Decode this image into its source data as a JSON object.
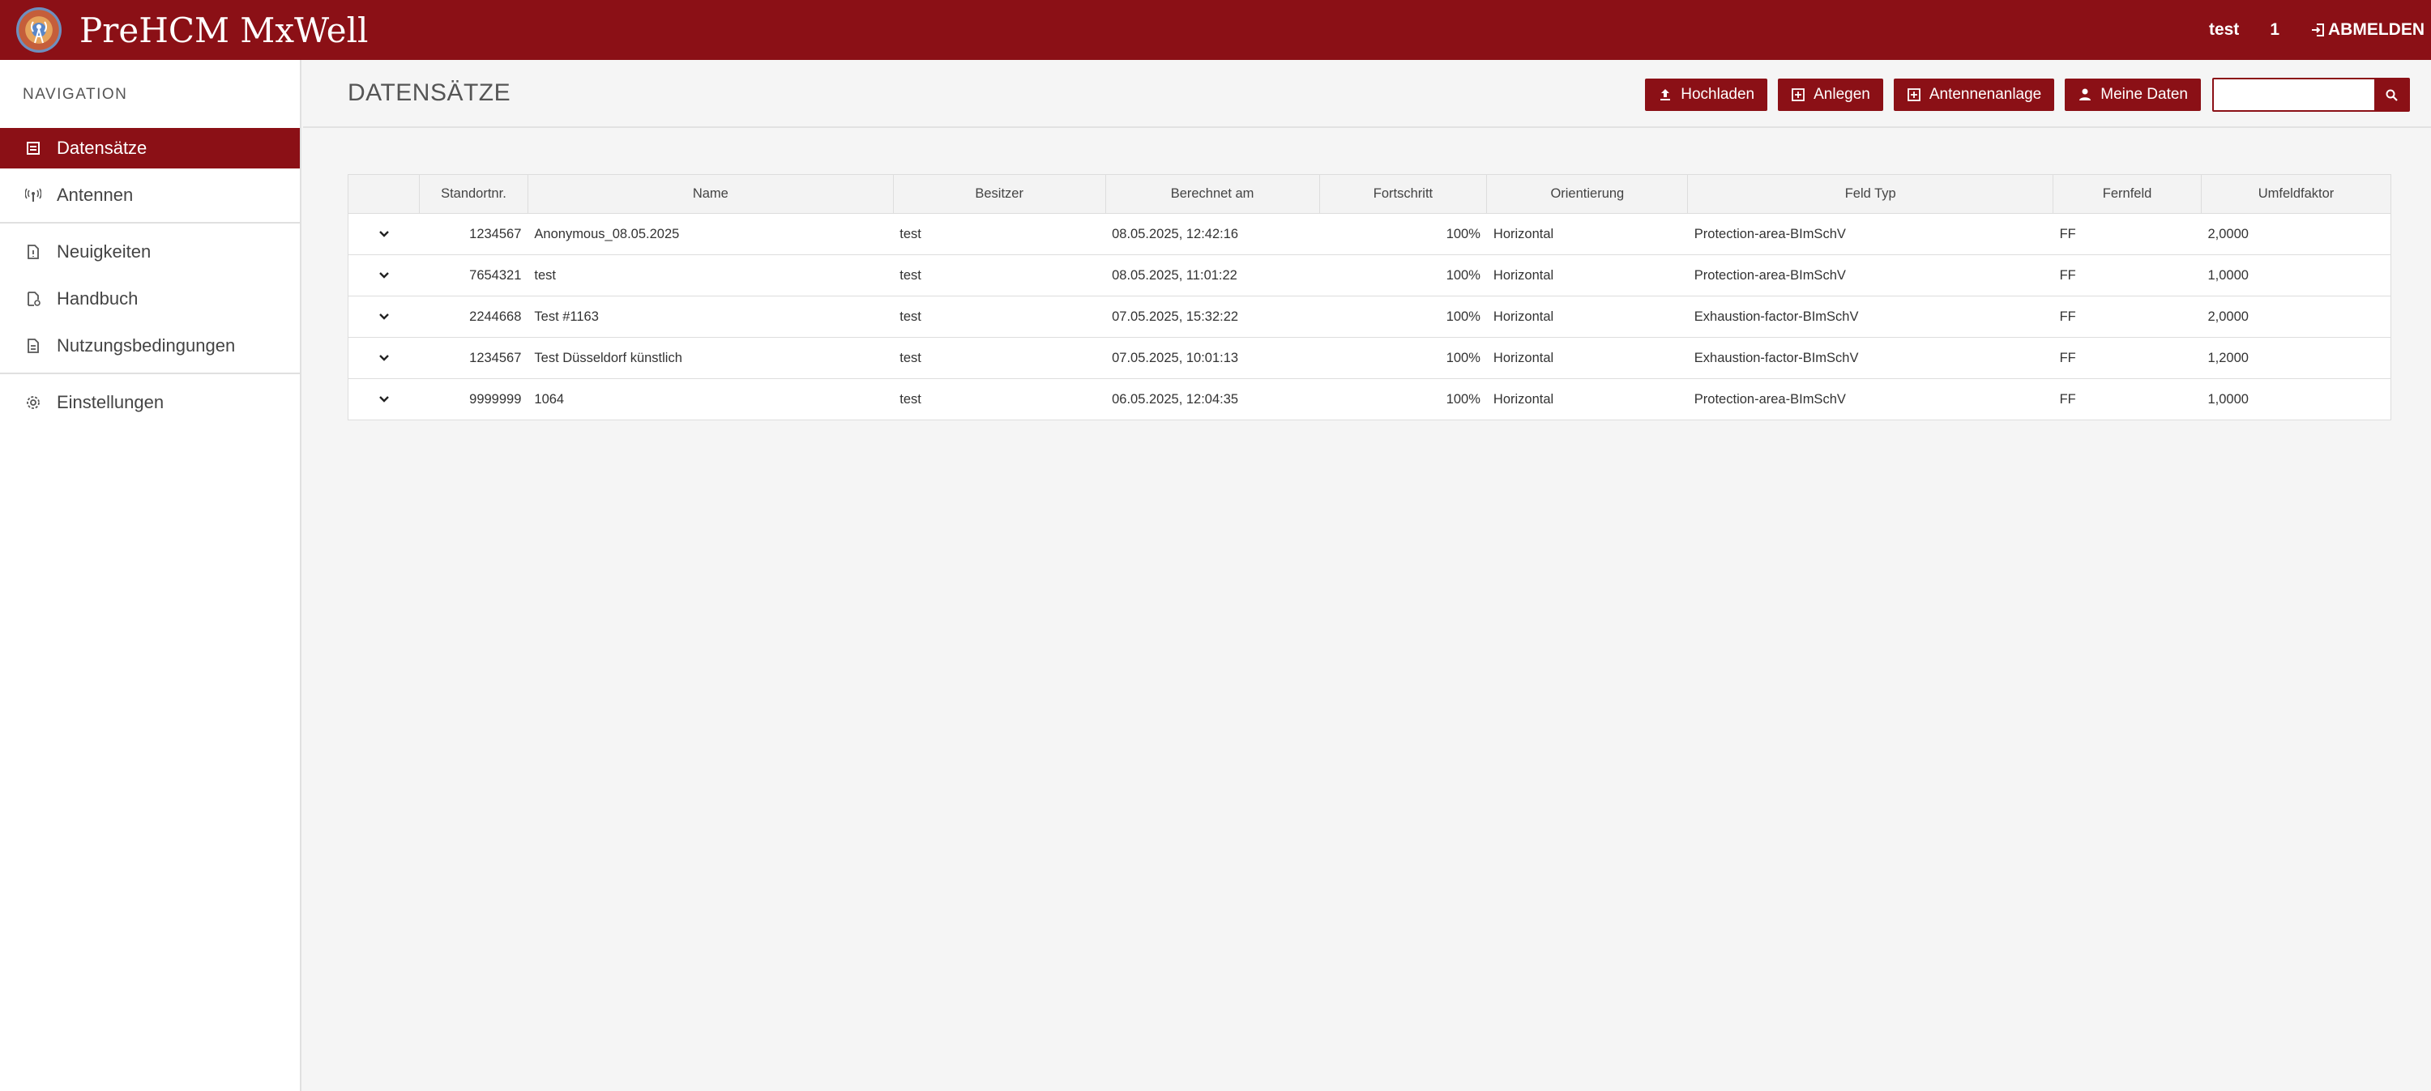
{
  "app": {
    "title": "PreHCM MxWell"
  },
  "topbar": {
    "user": "test",
    "count": "1",
    "logout_label": "ABMELDEN"
  },
  "sidebar": {
    "heading": "NAVIGATION",
    "items": [
      {
        "label": "Datensätze",
        "icon": "list-icon",
        "active": true
      },
      {
        "label": "Antennen",
        "icon": "antenna-icon"
      },
      {
        "label": "Neuigkeiten",
        "icon": "news-icon"
      },
      {
        "label": "Handbuch",
        "icon": "manual-icon"
      },
      {
        "label": "Nutzungsbedingungen",
        "icon": "terms-icon"
      },
      {
        "label": "Einstellungen",
        "icon": "gear-icon"
      }
    ]
  },
  "main": {
    "title": "DATENSÄTZE",
    "toolbar": {
      "upload_label": "Hochladen",
      "create_label": "Anlegen",
      "antenna_system_label": "Antennenanlage",
      "my_data_label": "Meine Daten",
      "search_placeholder": ""
    }
  },
  "table": {
    "columns": [
      "",
      "Standortnr.",
      "Name",
      "Besitzer",
      "Berechnet am",
      "Fortschritt",
      "Orientierung",
      "Feld Typ",
      "Fernfeld",
      "Umfeldfaktor"
    ],
    "rows": [
      {
        "standort": "1234567",
        "name": "Anonymous_08.05.2025",
        "besitzer": "test",
        "berechnet": "08.05.2025, 12:42:16",
        "fortschritt": "100%",
        "orientierung": "Horizontal",
        "feldtyp": "Protection-area-BImSchV",
        "fernfeld": "FF",
        "umfeld": "2,0000"
      },
      {
        "standort": "7654321",
        "name": "test",
        "besitzer": "test",
        "berechnet": "08.05.2025, 11:01:22",
        "fortschritt": "100%",
        "orientierung": "Horizontal",
        "feldtyp": "Protection-area-BImSchV",
        "fernfeld": "FF",
        "umfeld": "1,0000"
      },
      {
        "standort": "2244668",
        "name": "Test #1163",
        "besitzer": "test",
        "berechnet": "07.05.2025, 15:32:22",
        "fortschritt": "100%",
        "orientierung": "Horizontal",
        "feldtyp": "Exhaustion-factor-BImSchV",
        "fernfeld": "FF",
        "umfeld": "2,0000"
      },
      {
        "standort": "1234567",
        "name": "Test Düsseldorf künstlich",
        "besitzer": "test",
        "berechnet": "07.05.2025, 10:01:13",
        "fortschritt": "100%",
        "orientierung": "Horizontal",
        "feldtyp": "Exhaustion-factor-BImSchV",
        "fernfeld": "FF",
        "umfeld": "1,2000"
      },
      {
        "standort": "9999999",
        "name": "1064",
        "besitzer": "test",
        "berechnet": "06.05.2025, 12:04:35",
        "fortschritt": "100%",
        "orientierung": "Horizontal",
        "feldtyp": "Protection-area-BImSchV",
        "fernfeld": "FF",
        "umfeld": "1,0000"
      }
    ]
  },
  "colors": {
    "brand": "#8b1016",
    "background": "#f5f5f5"
  }
}
